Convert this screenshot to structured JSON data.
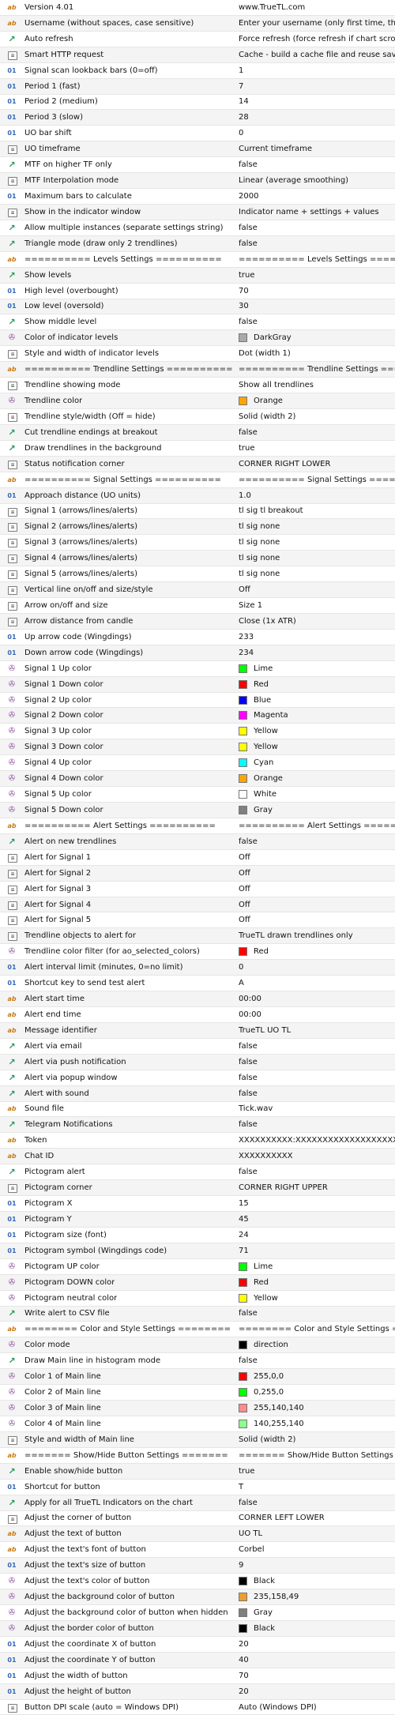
{
  "rows": [
    {
      "type": "ab",
      "label": "Version 4.01",
      "value": "www.TrueTL.com"
    },
    {
      "type": "ab",
      "label": "Username (without spaces, case sensitive)",
      "value": "Enter your username (only first time, then leave empty)"
    },
    {
      "type": "bool",
      "label": "Auto refresh",
      "value": "Force refresh (force refresh if chart scrolling)"
    },
    {
      "type": "enum",
      "label": "Smart HTTP request",
      "value": "Cache - build a cache file and reuse saved results"
    },
    {
      "type": "01",
      "label": "Signal scan lookback bars (0=off)",
      "value": "1"
    },
    {
      "type": "01",
      "label": "Period 1 (fast)",
      "value": "7"
    },
    {
      "type": "01",
      "label": "Period 2 (medium)",
      "value": "14"
    },
    {
      "type": "01",
      "label": "Period 3 (slow)",
      "value": "28"
    },
    {
      "type": "01",
      "label": "UO bar shift",
      "value": "0"
    },
    {
      "type": "enum",
      "label": "UO timeframe",
      "value": "Current timeframe"
    },
    {
      "type": "bool",
      "label": "MTF on higher TF only",
      "value": "false"
    },
    {
      "type": "enum",
      "label": "MTF Interpolation mode",
      "value": "Linear (average smoothing)"
    },
    {
      "type": "01",
      "label": "Maximum bars to calculate",
      "value": "2000"
    },
    {
      "type": "enum",
      "label": "Show in the indicator window",
      "value": "Indicator name + settings + values"
    },
    {
      "type": "bool",
      "label": "Allow multiple instances (separate settings string)",
      "value": "false"
    },
    {
      "type": "bool",
      "label": "Triangle mode (draw only 2 trendlines)",
      "value": "false"
    },
    {
      "type": "ab",
      "label": "========== Levels Settings ==========",
      "value": "========== Levels Settings =========="
    },
    {
      "type": "bool",
      "label": "Show levels",
      "value": "true"
    },
    {
      "type": "01",
      "label": "High level (overbought)",
      "value": "70"
    },
    {
      "type": "01",
      "label": "Low level (oversold)",
      "value": "30"
    },
    {
      "type": "bool",
      "label": "Show middle level",
      "value": "false"
    },
    {
      "type": "color",
      "label": "Color of indicator levels",
      "value": "DarkGray",
      "color": "#a9a9a9"
    },
    {
      "type": "enum",
      "label": "Style and width of indicator levels",
      "value": "Dot (width 1)"
    },
    {
      "type": "ab",
      "label": "========== Trendline Settings ==========",
      "value": "========== Trendline Settings =========="
    },
    {
      "type": "enum",
      "label": "Trendline showing mode",
      "value": "Show all trendlines"
    },
    {
      "type": "color",
      "label": "Trendline color",
      "value": "Orange",
      "color": "#ffa500"
    },
    {
      "type": "enum",
      "label": "Trendline style/width (Off = hide)",
      "value": "Solid (width 2)"
    },
    {
      "type": "bool",
      "label": "Cut trendline endings at breakout",
      "value": "false"
    },
    {
      "type": "bool",
      "label": "Draw trendlines in the background",
      "value": "true"
    },
    {
      "type": "enum",
      "label": "Status notification corner",
      "value": "CORNER RIGHT LOWER"
    },
    {
      "type": "ab",
      "label": "========== Signal Settings ==========",
      "value": "========== Signal Settings =========="
    },
    {
      "type": "01",
      "label": "Approach distance (UO units)",
      "value": "1.0"
    },
    {
      "type": "enum",
      "label": "Signal 1 (arrows/lines/alerts)",
      "value": "tl sig tl breakout"
    },
    {
      "type": "enum",
      "label": "Signal 2 (arrows/lines/alerts)",
      "value": "tl sig none"
    },
    {
      "type": "enum",
      "label": "Signal 3 (arrows/lines/alerts)",
      "value": "tl sig none"
    },
    {
      "type": "enum",
      "label": "Signal 4 (arrows/lines/alerts)",
      "value": "tl sig none"
    },
    {
      "type": "enum",
      "label": "Signal 5 (arrows/lines/alerts)",
      "value": "tl sig none"
    },
    {
      "type": "enum",
      "label": "Vertical line on/off and size/style",
      "value": "Off"
    },
    {
      "type": "enum",
      "label": "Arrow on/off and size",
      "value": "Size 1"
    },
    {
      "type": "enum",
      "label": "Arrow distance from candle",
      "value": "Close (1x ATR)"
    },
    {
      "type": "01",
      "label": "Up arrow code (Wingdings)",
      "value": "233"
    },
    {
      "type": "01",
      "label": "Down arrow code (Wingdings)",
      "value": "234"
    },
    {
      "type": "color",
      "label": "Signal 1 Up color",
      "value": "Lime",
      "color": "#00ff00"
    },
    {
      "type": "color",
      "label": "Signal 1 Down color",
      "value": "Red",
      "color": "#ff0000"
    },
    {
      "type": "color",
      "label": "Signal 2 Up color",
      "value": "Blue",
      "color": "#0000ff"
    },
    {
      "type": "color",
      "label": "Signal 2 Down color",
      "value": "Magenta",
      "color": "#ff00ff"
    },
    {
      "type": "color",
      "label": "Signal 3 Up color",
      "value": "Yellow",
      "color": "#ffff00"
    },
    {
      "type": "color",
      "label": "Signal 3 Down color",
      "value": "Yellow",
      "color": "#ffff00"
    },
    {
      "type": "color",
      "label": "Signal 4 Up color",
      "value": "Cyan",
      "color": "#00ffff"
    },
    {
      "type": "color",
      "label": "Signal 4 Down color",
      "value": "Orange",
      "color": "#ffa500"
    },
    {
      "type": "color",
      "label": "Signal 5 Up color",
      "value": "White",
      "color": "#ffffff"
    },
    {
      "type": "color",
      "label": "Signal 5 Down color",
      "value": "Gray",
      "color": "#808080"
    },
    {
      "type": "ab",
      "label": "========== Alert Settings ==========",
      "value": "========== Alert Settings =========="
    },
    {
      "type": "bool",
      "label": "Alert on new trendlines",
      "value": "false"
    },
    {
      "type": "enum",
      "label": "Alert for Signal 1",
      "value": "Off"
    },
    {
      "type": "enum",
      "label": "Alert for Signal 2",
      "value": "Off"
    },
    {
      "type": "enum",
      "label": "Alert for Signal 3",
      "value": "Off"
    },
    {
      "type": "enum",
      "label": "Alert for Signal 4",
      "value": "Off"
    },
    {
      "type": "enum",
      "label": "Alert for Signal 5",
      "value": "Off"
    },
    {
      "type": "enum",
      "label": "Trendline objects to alert for",
      "value": "TrueTL drawn trendlines only"
    },
    {
      "type": "color",
      "label": "Trendline color filter (for ao_selected_colors)",
      "value": "Red",
      "color": "#ff0000"
    },
    {
      "type": "01",
      "label": "Alert interval limit (minutes, 0=no limit)",
      "value": "0"
    },
    {
      "type": "01",
      "label": "Shortcut key to send test alert",
      "value": "A"
    },
    {
      "type": "ab",
      "label": "Alert start time",
      "value": "00:00"
    },
    {
      "type": "ab",
      "label": "Alert end time",
      "value": "00:00"
    },
    {
      "type": "ab",
      "label": "Message identifier",
      "value": "TrueTL UO TL"
    },
    {
      "type": "bool",
      "label": "Alert via email",
      "value": "false"
    },
    {
      "type": "bool",
      "label": "Alert via push notification",
      "value": "false"
    },
    {
      "type": "bool",
      "label": "Alert via popup window",
      "value": "false"
    },
    {
      "type": "bool",
      "label": "Alert with sound",
      "value": "false"
    },
    {
      "type": "ab",
      "label": "Sound file",
      "value": "Tick.wav"
    },
    {
      "type": "bool",
      "label": "Telegram Notifications",
      "value": "false"
    },
    {
      "type": "ab",
      "label": "Token",
      "value": "XXXXXXXXXX:XXXXXXXXXXXXXXXXXXXXXXXXXXXXXXXXXXX"
    },
    {
      "type": "ab",
      "label": "Chat ID",
      "value": "XXXXXXXXXX"
    },
    {
      "type": "bool",
      "label": "Pictogram alert",
      "value": "false"
    },
    {
      "type": "enum",
      "label": "Pictogram corner",
      "value": "CORNER RIGHT UPPER"
    },
    {
      "type": "01",
      "label": "Pictogram X",
      "value": "15"
    },
    {
      "type": "01",
      "label": "Pictogram Y",
      "value": "45"
    },
    {
      "type": "01",
      "label": "Pictogram size (font)",
      "value": "24"
    },
    {
      "type": "01",
      "label": "Pictogram symbol (Wingdings code)",
      "value": "71"
    },
    {
      "type": "color",
      "label": "Pictogram UP color",
      "value": "Lime",
      "color": "#00ff00"
    },
    {
      "type": "color",
      "label": "Pictogram DOWN color",
      "value": "Red",
      "color": "#ff0000"
    },
    {
      "type": "color",
      "label": "Pictogram neutral color",
      "value": "Yellow",
      "color": "#ffff00"
    },
    {
      "type": "bool",
      "label": "Write alert to CSV file",
      "value": "false"
    },
    {
      "type": "ab",
      "label": "======== Color and Style Settings ========",
      "value": "======== Color and Style Settings ========"
    },
    {
      "type": "color",
      "label": "Color mode",
      "value": "direction",
      "color": "#000000"
    },
    {
      "type": "bool",
      "label": "Draw Main line in histogram mode",
      "value": "false"
    },
    {
      "type": "color",
      "label": "Color 1 of Main line",
      "value": "255,0,0",
      "color": "#ff0000"
    },
    {
      "type": "color",
      "label": "Color 2 of Main line",
      "value": "0,255,0",
      "color": "#00ff00"
    },
    {
      "type": "color",
      "label": "Color 3 of Main line",
      "value": "255,140,140",
      "color": "#ff8c8c"
    },
    {
      "type": "color",
      "label": "Color 4 of Main line",
      "value": "140,255,140",
      "color": "#8cff8c"
    },
    {
      "type": "enum",
      "label": "Style and width of Main line",
      "value": "Solid (width 2)"
    },
    {
      "type": "ab",
      "label": "======= Show/Hide Button Settings =======",
      "value": "======= Show/Hide Button Settings ======="
    },
    {
      "type": "bool",
      "label": "Enable show/hide button",
      "value": "true"
    },
    {
      "type": "01",
      "label": "Shortcut for button",
      "value": "T"
    },
    {
      "type": "bool",
      "label": "Apply for all TrueTL Indicators on the chart",
      "value": "false"
    },
    {
      "type": "enum",
      "label": "Adjust the corner of button",
      "value": "CORNER LEFT LOWER"
    },
    {
      "type": "ab",
      "label": "Adjust the text of button",
      "value": "UO TL"
    },
    {
      "type": "ab",
      "label": "Adjust the text's font of button",
      "value": "Corbel"
    },
    {
      "type": "01",
      "label": "Adjust the text's size of button",
      "value": "9"
    },
    {
      "type": "color",
      "label": "Adjust the text's color of button",
      "value": "Black",
      "color": "#000000"
    },
    {
      "type": "color",
      "label": "Adjust the background color of button",
      "value": "235,158,49",
      "color": "#eb9e31"
    },
    {
      "type": "color",
      "label": "Adjust the background color of button when hidden",
      "value": "Gray",
      "color": "#808080"
    },
    {
      "type": "color",
      "label": "Adjust the border color of button",
      "value": "Black",
      "color": "#000000"
    },
    {
      "type": "01",
      "label": "Adjust the coordinate X of button",
      "value": "20"
    },
    {
      "type": "01",
      "label": "Adjust the coordinate Y of button",
      "value": "40"
    },
    {
      "type": "01",
      "label": "Adjust the width of button",
      "value": "70"
    },
    {
      "type": "01",
      "label": "Adjust the height of button",
      "value": "20"
    },
    {
      "type": "enum",
      "label": "Button DPI scale (auto = Windows DPI)",
      "value": "Auto (Windows DPI)"
    }
  ]
}
